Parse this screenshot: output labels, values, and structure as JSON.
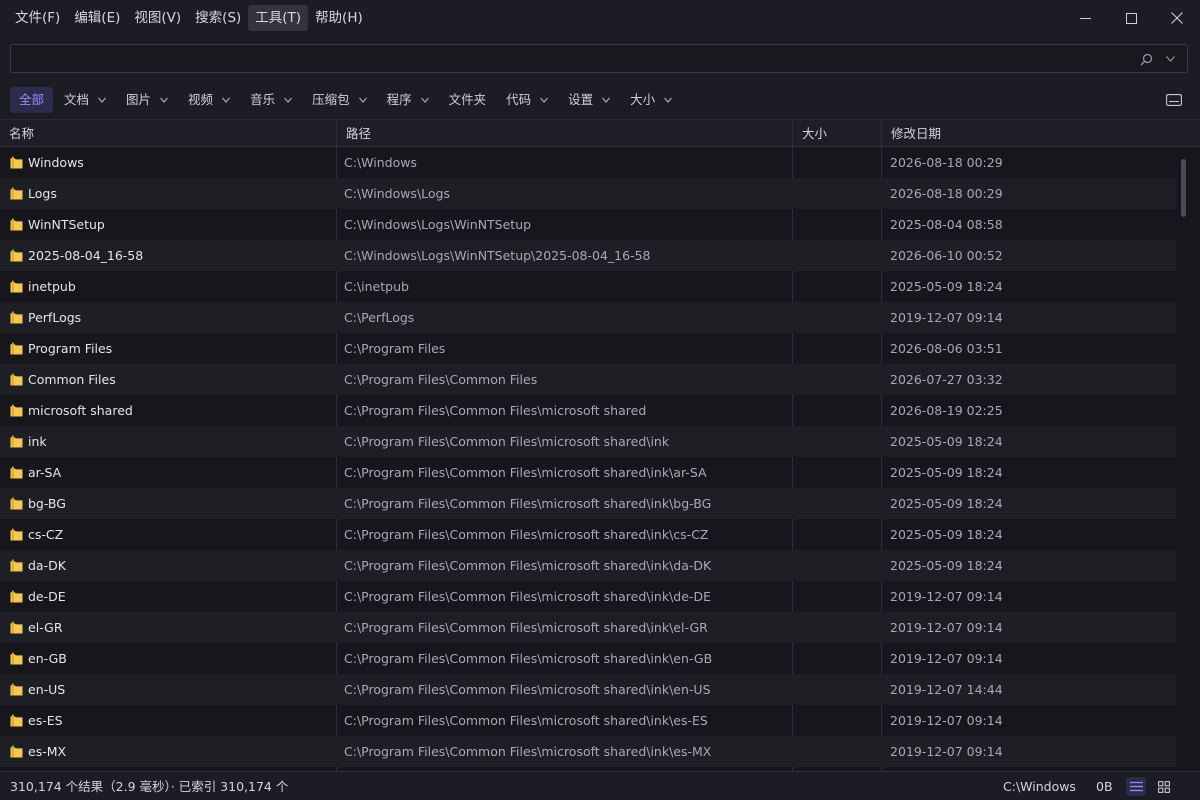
{
  "menu": [
    "文件(F)",
    "编辑(E)",
    "视图(V)",
    "搜索(S)",
    "工具(T)",
    "帮助(H)"
  ],
  "menu_active": 4,
  "window_controls": [
    "minimize-icon",
    "maximize-icon",
    "close-icon"
  ],
  "search": {
    "value": "",
    "placeholder": "",
    "search_icon": "search-icon",
    "dropdown_icon": "chevron-down-icon"
  },
  "filters": [
    {
      "label": "全部",
      "active": true,
      "dropdown": false
    },
    {
      "label": "文档",
      "active": false,
      "dropdown": true
    },
    {
      "label": "图片",
      "active": false,
      "dropdown": true
    },
    {
      "label": "视频",
      "active": false,
      "dropdown": true
    },
    {
      "label": "音乐",
      "active": false,
      "dropdown": true
    },
    {
      "label": "压缩包",
      "active": false,
      "dropdown": true
    },
    {
      "label": "程序",
      "active": false,
      "dropdown": true
    },
    {
      "label": "文件夹",
      "active": false,
      "dropdown": false
    },
    {
      "label": "代码",
      "active": false,
      "dropdown": true
    },
    {
      "label": "设置",
      "active": false,
      "dropdown": true
    },
    {
      "label": "大小",
      "active": false,
      "dropdown": true
    }
  ],
  "columns": {
    "name": "名称",
    "path": "路径",
    "size": "大小",
    "date": "修改日期"
  },
  "rows": [
    {
      "name": "Windows",
      "path": "C:\\Windows",
      "size": "",
      "date": "2026-08-18 00:29"
    },
    {
      "name": "Logs",
      "path": "C:\\Windows\\Logs",
      "size": "",
      "date": "2026-08-18 00:29"
    },
    {
      "name": "WinNTSetup",
      "path": "C:\\Windows\\Logs\\WinNTSetup",
      "size": "",
      "date": "2025-08-04 08:58"
    },
    {
      "name": "2025-08-04_16-58",
      "path": "C:\\Windows\\Logs\\WinNTSetup\\2025-08-04_16-58",
      "size": "",
      "date": "2026-06-10 00:52"
    },
    {
      "name": "inetpub",
      "path": "C:\\inetpub",
      "size": "",
      "date": "2025-05-09 18:24"
    },
    {
      "name": "PerfLogs",
      "path": "C:\\PerfLogs",
      "size": "",
      "date": "2019-12-07 09:14"
    },
    {
      "name": "Program Files",
      "path": "C:\\Program Files",
      "size": "",
      "date": "2026-08-06 03:51"
    },
    {
      "name": "Common Files",
      "path": "C:\\Program Files\\Common Files",
      "size": "",
      "date": "2026-07-27 03:32"
    },
    {
      "name": "microsoft shared",
      "path": "C:\\Program Files\\Common Files\\microsoft shared",
      "size": "",
      "date": "2026-08-19 02:25"
    },
    {
      "name": "ink",
      "path": "C:\\Program Files\\Common Files\\microsoft shared\\ink",
      "size": "",
      "date": "2025-05-09 18:24"
    },
    {
      "name": "ar-SA",
      "path": "C:\\Program Files\\Common Files\\microsoft shared\\ink\\ar-SA",
      "size": "",
      "date": "2025-05-09 18:24"
    },
    {
      "name": "bg-BG",
      "path": "C:\\Program Files\\Common Files\\microsoft shared\\ink\\bg-BG",
      "size": "",
      "date": "2025-05-09 18:24"
    },
    {
      "name": "cs-CZ",
      "path": "C:\\Program Files\\Common Files\\microsoft shared\\ink\\cs-CZ",
      "size": "",
      "date": "2025-05-09 18:24"
    },
    {
      "name": "da-DK",
      "path": "C:\\Program Files\\Common Files\\microsoft shared\\ink\\da-DK",
      "size": "",
      "date": "2025-05-09 18:24"
    },
    {
      "name": "de-DE",
      "path": "C:\\Program Files\\Common Files\\microsoft shared\\ink\\de-DE",
      "size": "",
      "date": "2019-12-07 09:14"
    },
    {
      "name": "el-GR",
      "path": "C:\\Program Files\\Common Files\\microsoft shared\\ink\\el-GR",
      "size": "",
      "date": "2019-12-07 09:14"
    },
    {
      "name": "en-GB",
      "path": "C:\\Program Files\\Common Files\\microsoft shared\\ink\\en-GB",
      "size": "",
      "date": "2019-12-07 09:14"
    },
    {
      "name": "en-US",
      "path": "C:\\Program Files\\Common Files\\microsoft shared\\ink\\en-US",
      "size": "",
      "date": "2019-12-07 14:44"
    },
    {
      "name": "es-ES",
      "path": "C:\\Program Files\\Common Files\\microsoft shared\\ink\\es-ES",
      "size": "",
      "date": "2019-12-07 09:14"
    },
    {
      "name": "es-MX",
      "path": "C:\\Program Files\\Common Files\\microsoft shared\\ink\\es-MX",
      "size": "",
      "date": "2019-12-07 09:14"
    }
  ],
  "status": {
    "summary": "310,174 个结果（2.9 毫秒）· 已索引 310,174 个",
    "path": "C:\\Windows",
    "size": "0B",
    "view_icons": [
      "list-view-icon",
      "grid-view-icon"
    ]
  },
  "colors": {
    "background": "#16161c",
    "chrome": "#1c1c24",
    "accent": "#8f8fff",
    "folder": "#f3c94f"
  }
}
